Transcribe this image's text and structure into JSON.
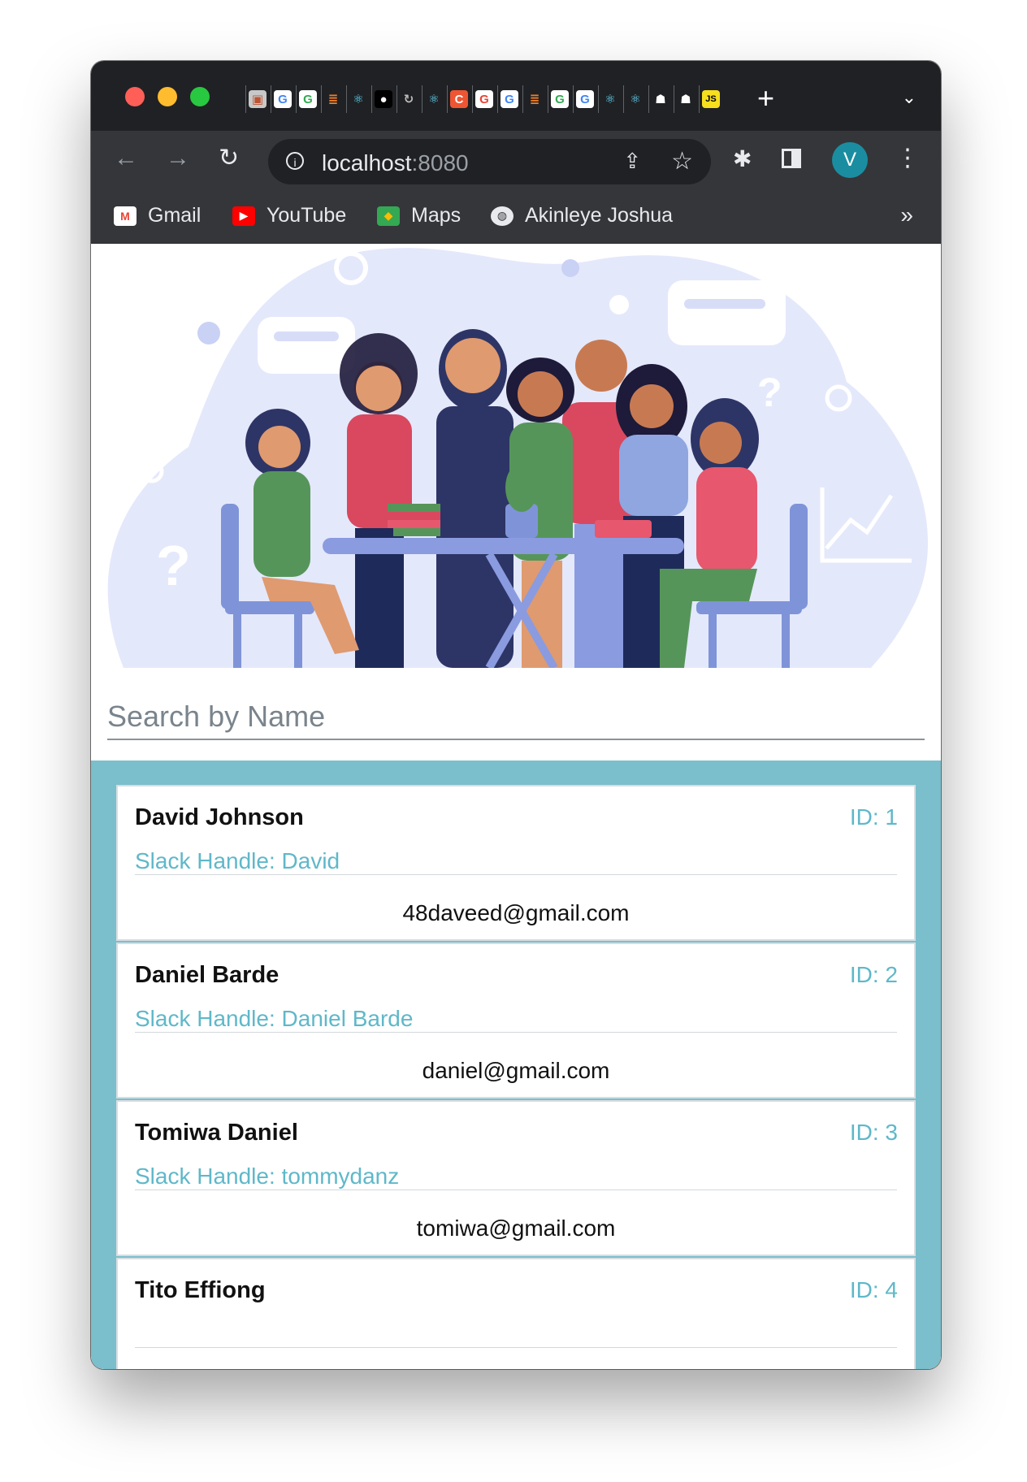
{
  "browser": {
    "url_host": "localhost",
    "url_port": ":8080",
    "profile_initial": "V",
    "tab_favicons": [
      "archive-icon",
      "google-icon",
      "google-icon",
      "stackoverflow-icon",
      "react-icon",
      "medium-icon",
      "refresh-icon",
      "react-icon",
      "codepen-icon",
      "google-icon",
      "google-icon",
      "stackoverflow-icon",
      "google-icon",
      "google-icon",
      "react-icon",
      "react-icon",
      "robot-icon",
      "robot-icon",
      "js-icon"
    ],
    "bookmarks": [
      {
        "label": "Gmail",
        "icon": "gmail-icon"
      },
      {
        "label": "YouTube",
        "icon": "youtube-icon"
      },
      {
        "label": "Maps",
        "icon": "maps-icon"
      },
      {
        "label": "Akinleye Joshua",
        "icon": "globe-icon"
      }
    ]
  },
  "search": {
    "placeholder": "Search by Name",
    "value": ""
  },
  "users": [
    {
      "name": "David Johnson",
      "id": "ID: 1",
      "slack": "Slack Handle: David",
      "email": "48daveed@gmail.com"
    },
    {
      "name": "Daniel Barde",
      "id": "ID: 2",
      "slack": "Slack Handle: Daniel Barde",
      "email": "daniel@gmail.com"
    },
    {
      "name": "Tomiwa Daniel",
      "id": "ID: 3",
      "slack": "Slack Handle: tommydanz",
      "email": "tomiwa@gmail.com"
    },
    {
      "name": "Tito Effiong",
      "id": "ID: 4",
      "slack": "",
      "email": ""
    }
  ],
  "colors": {
    "accent": "#5fb8c9",
    "list_bg": "#7abfcb",
    "hero_blob": "#e4e8fb"
  }
}
